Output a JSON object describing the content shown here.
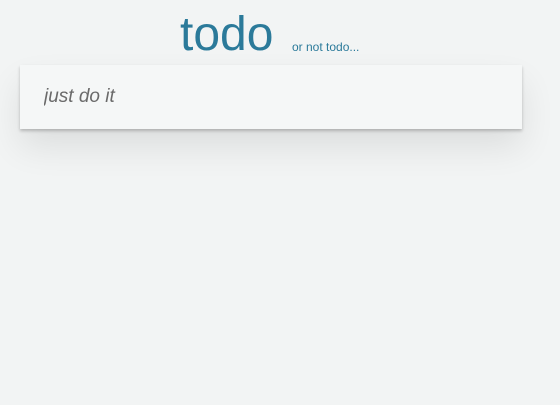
{
  "header": {
    "title": "todo",
    "subtitle": "or not todo..."
  },
  "new_todo": {
    "value": "",
    "placeholder": "just do it"
  },
  "colors": {
    "accent": "#2b7a9a",
    "background": "#f2f4f4",
    "card": "#f5f7f7",
    "placeholder": "#6a6a6a"
  }
}
